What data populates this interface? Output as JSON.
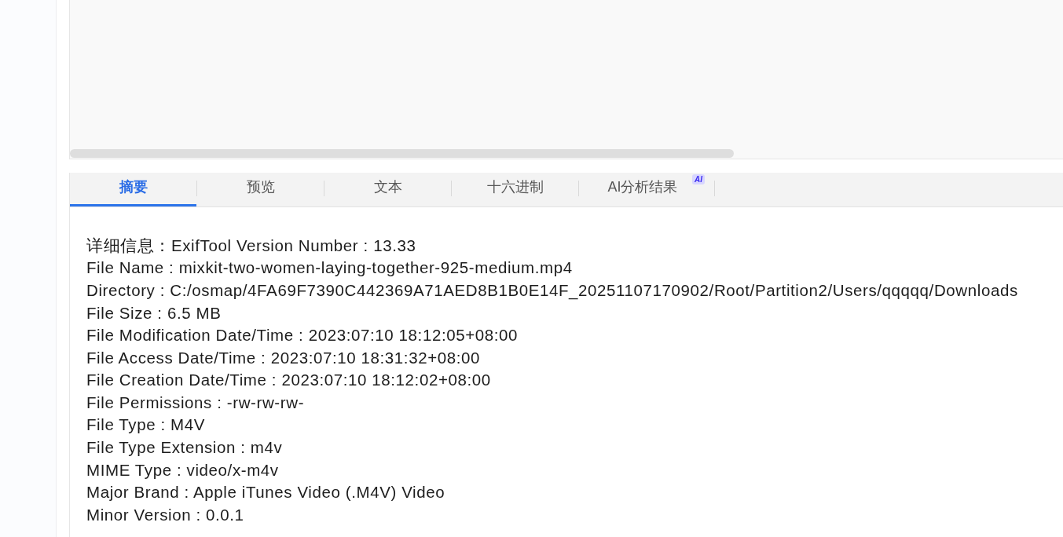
{
  "tabs": [
    {
      "label": "摘要",
      "selected": true
    },
    {
      "label": "预览",
      "selected": false
    },
    {
      "label": "文本",
      "selected": false
    },
    {
      "label": "十六进制",
      "selected": false
    },
    {
      "label": "AI分析结果",
      "selected": false,
      "badge": "AI"
    }
  ],
  "details": {
    "lines": [
      "详细信息：ExifTool Version Number : 13.33",
      "File Name : mixkit-two-women-laying-together-925-medium.mp4",
      "Directory : C:/osmap/4FA69F7390C442369A71AED8B1B0E14F_20251107170902/Root/Partition2/Users/qqqqq/Downloads",
      "File Size : 6.5 MB",
      "File Modification Date/Time : 2023:07:10 18:12:05+08:00",
      "File Access Date/Time : 2023:07:10 18:31:32+08:00",
      "File Creation Date/Time : 2023:07:10 18:12:02+08:00",
      "File Permissions : -rw-rw-rw-",
      "File Type : M4V",
      "File Type Extension : m4v",
      "MIME Type : video/x-m4v",
      "Major Brand : Apple iTunes Video (.M4V) Video",
      "Minor Version : 0.0.1"
    ]
  }
}
